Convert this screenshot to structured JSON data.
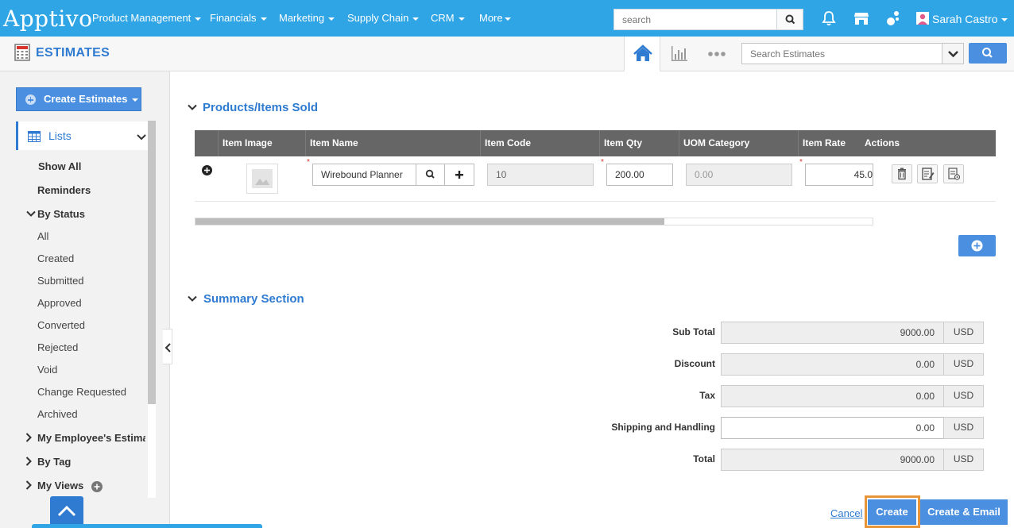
{
  "nav": {
    "logo": "Apptivo",
    "items": [
      "Product Management",
      "Financials",
      "Marketing",
      "Supply Chain",
      "CRM",
      "More"
    ],
    "search_placeholder": "search",
    "user_name": "Sarah Castro"
  },
  "app": {
    "title": "ESTIMATES",
    "search_placeholder": "Search Estimates"
  },
  "sidebar": {
    "create_label": "Create Estimates",
    "lists_label": "Lists",
    "show_all": "Show All",
    "reminders": "Reminders",
    "by_status": "By Status",
    "statuses": [
      "All",
      "Created",
      "Submitted",
      "Approved",
      "Converted",
      "Rejected",
      "Void",
      "Change Requested",
      "Archived"
    ],
    "my_employees": "My Employee's Estima",
    "by_tag": "By Tag",
    "my_views": "My Views"
  },
  "products": {
    "section_title": "Products/Items Sold",
    "columns": [
      "Item Image",
      "Item Name",
      "Item Code",
      "Item Qty",
      "UOM Category",
      "Item Rate",
      "Actions"
    ],
    "row": {
      "item_name": "Wirebound Planner",
      "item_code": "10",
      "item_qty": "200.00",
      "uom_category": "0.00",
      "item_rate": "45.0"
    }
  },
  "summary": {
    "section_title": "Summary Section",
    "rows": [
      {
        "label": "Sub Total",
        "value": "9000.00",
        "currency": "USD"
      },
      {
        "label": "Discount",
        "value": "0.00",
        "currency": "USD"
      },
      {
        "label": "Tax",
        "value": "0.00",
        "currency": "USD"
      },
      {
        "label": "Shipping and Handling",
        "value": "0.00",
        "currency": "USD"
      },
      {
        "label": "Total",
        "value": "9000.00",
        "currency": "USD"
      }
    ]
  },
  "actions": {
    "cancel": "Cancel",
    "create": "Create",
    "create_email": "Create & Email"
  },
  "colors": {
    "topbar": "#2fa5e6",
    "accent": "#2f7bd1",
    "button": "#4a8fe0",
    "highlight": "#e8953a"
  }
}
